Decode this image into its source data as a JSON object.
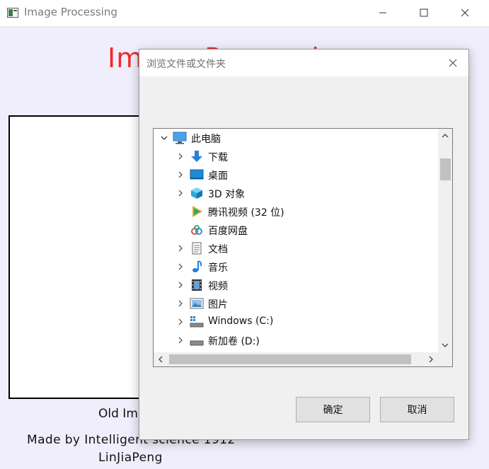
{
  "main_window": {
    "title": "Image Processing",
    "heading": "Image Processing",
    "image_caption": "Old Im",
    "credit": "Made by Intelligent science 1912",
    "author": "LinJiaPeng"
  },
  "dialog": {
    "title": "浏览文件或文件夹",
    "tree": [
      {
        "label": "此电脑",
        "icon": "computer-icon",
        "expanded": true,
        "level": 0
      },
      {
        "label": "下载",
        "icon": "download-icon",
        "level": 1
      },
      {
        "label": "桌面",
        "icon": "desktop-icon",
        "level": 1
      },
      {
        "label": "3D 对象",
        "icon": "3d-objects-icon",
        "level": 1
      },
      {
        "label": "腾讯视频 (32 位)",
        "icon": "tencent-video-icon",
        "level": 1,
        "no_chevron": true
      },
      {
        "label": "百度网盘",
        "icon": "baidu-netdisk-icon",
        "level": 1,
        "no_chevron": true
      },
      {
        "label": "文档",
        "icon": "documents-icon",
        "level": 1
      },
      {
        "label": "音乐",
        "icon": "music-icon",
        "level": 1
      },
      {
        "label": "视频",
        "icon": "videos-icon",
        "level": 1
      },
      {
        "label": "图片",
        "icon": "pictures-icon",
        "level": 1
      },
      {
        "label": "Windows (C:)",
        "icon": "system-drive-icon",
        "level": 1
      },
      {
        "label": "新加卷 (D:)",
        "icon": "drive-icon",
        "level": 1
      }
    ],
    "ok_label": "确定",
    "cancel_label": "取消"
  },
  "colors": {
    "window_bg": "#f0eefc",
    "heading_red": "#ef2b2b",
    "dialog_bg": "#f0f0f0"
  }
}
